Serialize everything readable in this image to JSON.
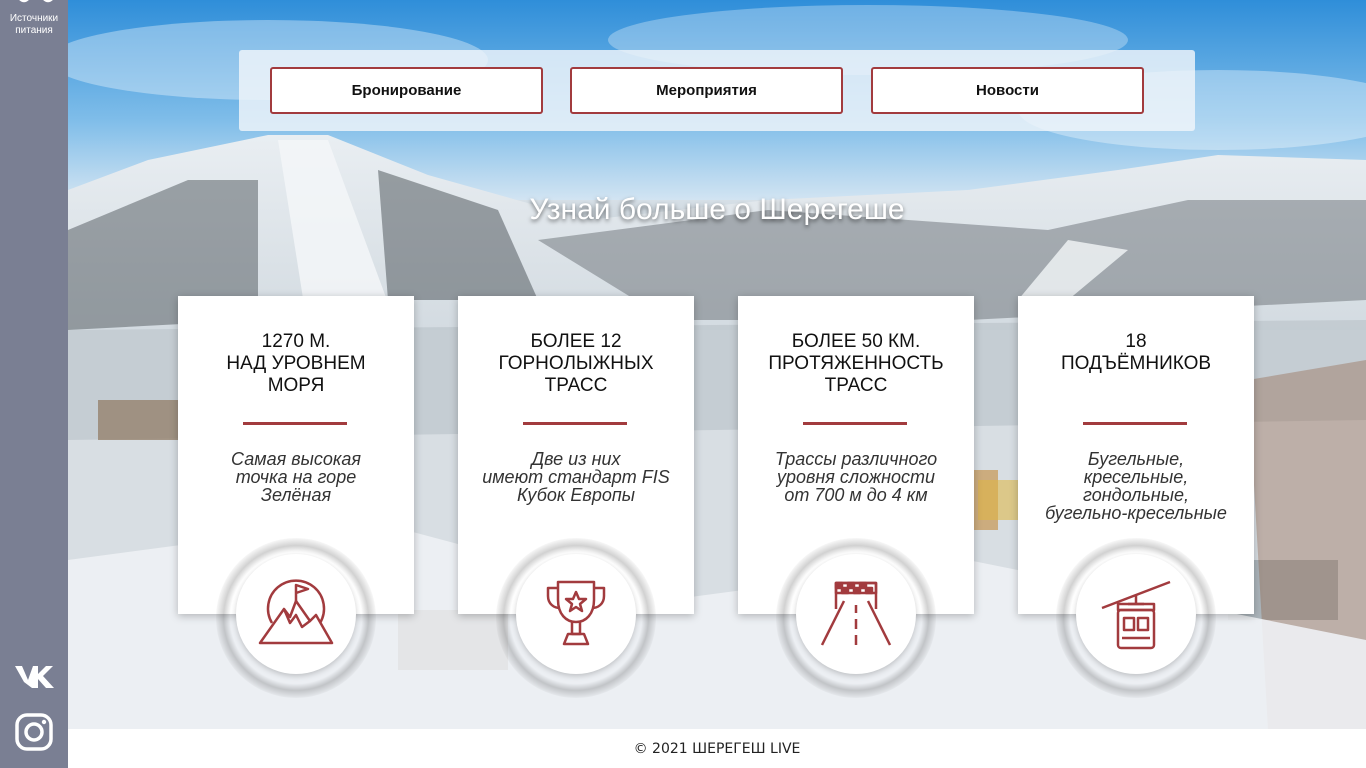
{
  "sidebar": {
    "sources_label_line1": "Источники",
    "sources_label_line2": "питания",
    "social": [
      "vk-icon",
      "instagram-icon"
    ]
  },
  "nav": {
    "items": [
      {
        "label": "Бронирование"
      },
      {
        "label": "Мероприятия"
      },
      {
        "label": "Новости"
      }
    ]
  },
  "hero": {
    "title": "Узнай больше о Шерегеше"
  },
  "cards": [
    {
      "title_lines": [
        "1270 м.",
        "над уровнем",
        "моря"
      ],
      "desc_lines": [
        "Самая высокая",
        "точка на горе",
        "Зелёная"
      ],
      "icon": "mountain-flag-icon"
    },
    {
      "title_lines": [
        "Более 12",
        "горнолыжных",
        "трасс"
      ],
      "desc_lines": [
        "Две из них",
        "имеют стандарт FIS",
        "Кубок Европы"
      ],
      "icon": "trophy-icon"
    },
    {
      "title_lines": [
        "Более 50 км.",
        "протяженность",
        "трасс"
      ],
      "desc_lines": [
        "Трассы различного",
        "уровня сложности",
        "от 700 м до 4 км"
      ],
      "icon": "finish-road-icon"
    },
    {
      "title_lines": [
        "18",
        "подъёмников"
      ],
      "desc_lines": [
        "Бугельные,",
        "кресельные,",
        "гондольные,",
        "бугельно-кресельные"
      ],
      "icon": "gondola-lift-icon"
    }
  ],
  "footer": {
    "text": "© 2021 ШЕРЕГЕШ LIVE"
  },
  "colors": {
    "accent": "#a23b3e",
    "sidebar": "#7a7f93"
  }
}
